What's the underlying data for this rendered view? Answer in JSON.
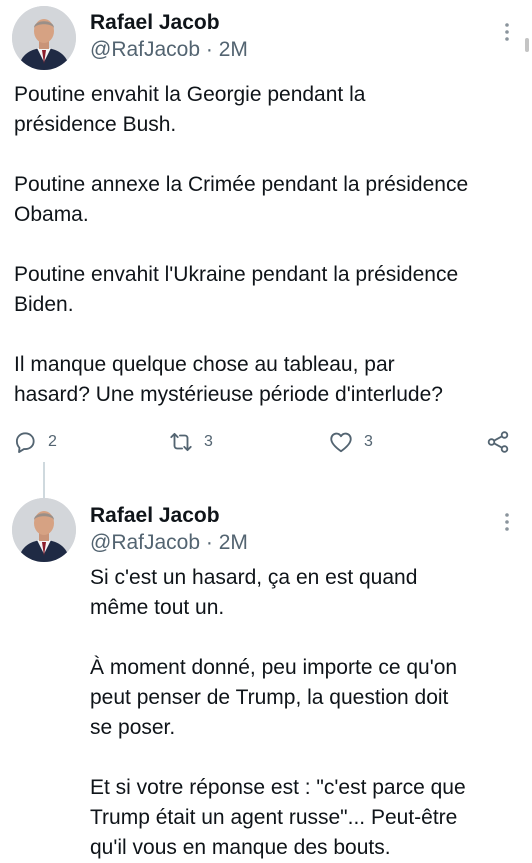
{
  "tweet1": {
    "display_name": "Rafael Jacob",
    "handle": "@RafJacob",
    "time_sep": " · ",
    "time": "2M",
    "text": "Poutine envahit la Georgie pendant la\nprésidence Bush.\n\nPoutine annexe la Crimée pendant la présidence\nObama.\n\nPoutine envahit l'Ukraine pendant la présidence\nBiden.\n\nIl manque quelque chose au tableau, par\nhasard? Une mystérieuse période d'interlude?",
    "actions": {
      "reply_count": "2",
      "retweet_count": "3",
      "like_count": "3"
    }
  },
  "tweet2": {
    "display_name": "Rafael Jacob",
    "handle": "@RafJacob",
    "time_sep": " · ",
    "time": "2M",
    "text": "Si c'est un hasard, ça en est quand\nmême tout un.\n\nÀ moment donné, peu importe ce qu'on\npeut penser de Trump, la question doit\nse poser.\n\nEt si votre réponse est : \"c'est parce que\nTrump était un agent russe\"... Peut-être\nqu'il vous en manque des bouts."
  },
  "icons": {
    "reply": "reply-icon",
    "retweet": "retweet-icon",
    "like": "heart-icon",
    "share": "share-icon",
    "more": "more-icon"
  },
  "colors": {
    "text": "#0f1419",
    "secondary": "#536471",
    "thread_line": "#cfd9de"
  }
}
